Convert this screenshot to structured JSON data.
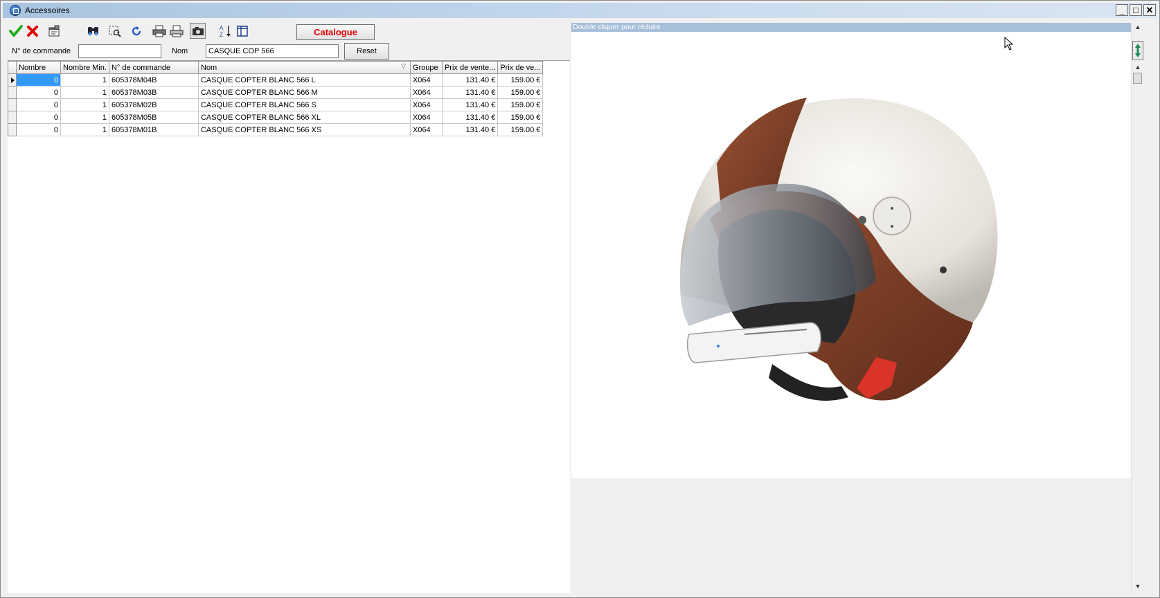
{
  "window": {
    "title": "Accessoires",
    "minimize_glyph": "_",
    "maximize_glyph": "□",
    "close_glyph": "✕"
  },
  "toolbar": {
    "buttons": [
      {
        "name": "validate-icon",
        "color": "#22aa22"
      },
      {
        "name": "cancel-icon",
        "color": "#e00000"
      },
      {
        "name": "properties-icon"
      },
      {
        "name": "search-binoculars-icon"
      },
      {
        "name": "zoom-select-icon"
      },
      {
        "name": "refresh-icon",
        "color": "#1a55c8"
      },
      {
        "name": "print-icon"
      },
      {
        "name": "print-preview-icon"
      },
      {
        "name": "camera-icon",
        "pressed": true
      },
      {
        "name": "sort-az-icon"
      },
      {
        "name": "columns-icon"
      }
    ],
    "catalogue_label": "Catalogue",
    "catalogue_color": "#e00000"
  },
  "filters": {
    "order_label": "N° de commande",
    "order_value": "",
    "name_label": "Nom",
    "name_value": "CASQUE COP 566",
    "reset_label": "Reset"
  },
  "table": {
    "columns": [
      "Nombre",
      "Nombre Min.",
      "N° de commande",
      "Nom",
      "Groupe",
      "Prix de vente...",
      "Prix de ve..."
    ],
    "rows": [
      [
        "0",
        "1",
        "605378M04B",
        "CASQUE COPTER BLANC 566 L",
        "X064",
        "131.40 €",
        "159.00 €"
      ],
      [
        "0",
        "1",
        "605378M03B",
        "CASQUE COPTER BLANC 566 M",
        "X064",
        "131.40 €",
        "159.00 €"
      ],
      [
        "0",
        "1",
        "605378M02B",
        "CASQUE COPTER BLANC 566 S",
        "X064",
        "131.40 €",
        "159.00 €"
      ],
      [
        "0",
        "1",
        "605378M05B",
        "CASQUE COPTER BLANC 566 XL",
        "X064",
        "131.40 €",
        "159.00 €"
      ],
      [
        "0",
        "1",
        "605378M01B",
        "CASQUE COPTER BLANC 566 XS",
        "X064",
        "131.40 €",
        "159.00 €"
      ]
    ],
    "current_row": 0,
    "sorted_column": "Nom"
  },
  "preview": {
    "hint": "Double cliquer pour réduire",
    "image_subject": "helmet",
    "colors": {
      "shell": "#e9e6e0",
      "leather": "#7b3e27",
      "visor": "#8d949c",
      "clip": "#d9332a"
    }
  }
}
